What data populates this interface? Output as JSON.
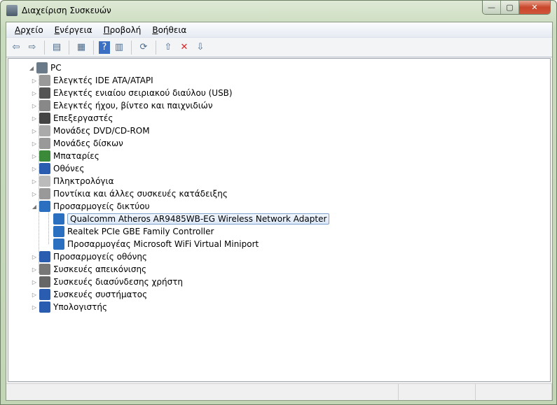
{
  "window": {
    "title": "Διαχείριση Συσκευών",
    "controls": {
      "minimize": "—",
      "maximize": "▢",
      "close": "✕"
    }
  },
  "menu": [
    {
      "key": "Α",
      "rest": "ρχείο"
    },
    {
      "key": "Ε",
      "rest": "νέργεια"
    },
    {
      "key": "Π",
      "rest": "ροβολή"
    },
    {
      "key": "Β",
      "rest": "οήθεια"
    }
  ],
  "toolbar": [
    {
      "icon": "back-icon",
      "glyph": "⇦"
    },
    {
      "icon": "forward-icon",
      "glyph": "⇨"
    },
    {
      "sep": true
    },
    {
      "icon": "show-hide-console-tree-icon",
      "glyph": "▤"
    },
    {
      "sep": true
    },
    {
      "icon": "properties-icon",
      "glyph": "▦"
    },
    {
      "sep": true
    },
    {
      "icon": "help-icon",
      "glyph": "?"
    },
    {
      "icon": "action-pane-icon",
      "glyph": "▥"
    },
    {
      "sep": true
    },
    {
      "icon": "scan-hardware-icon",
      "glyph": "⟳"
    },
    {
      "sep": true
    },
    {
      "icon": "update-driver-icon",
      "glyph": "⇧"
    },
    {
      "icon": "uninstall-icon",
      "glyph": "✕"
    },
    {
      "icon": "disable-icon",
      "glyph": "⇩"
    }
  ],
  "tree": {
    "root": "PC",
    "categories": [
      {
        "label": "Ελεγκτές IDE ATA/ATAPI",
        "color": "#999"
      },
      {
        "label": "Ελεγκτές ενιαίου σειριακού διαύλου (USB)",
        "color": "#555"
      },
      {
        "label": "Ελεγκτές ήχου, βίντεο και παιχνιδιών",
        "color": "#888"
      },
      {
        "label": "Επεξεργαστές",
        "color": "#444"
      },
      {
        "label": "Μονάδες DVD/CD-ROM",
        "color": "#aaa"
      },
      {
        "label": "Μονάδες δίσκων",
        "color": "#999"
      },
      {
        "label": "Μπαταρίες",
        "color": "#3a8a3a"
      },
      {
        "label": "Οθόνες",
        "color": "#2a5db0"
      },
      {
        "label": "Πληκτρολόγια",
        "color": "#bbb"
      },
      {
        "label": "Ποντίκια και άλλες συσκευές κατάδειξης",
        "color": "#999"
      },
      {
        "label": "Προσαρμογείς δικτύου",
        "color": "#2a6fc0",
        "expanded": true,
        "children": [
          {
            "label": "Qualcomm Atheros AR9485WB-EG Wireless Network Adapter",
            "selected": true
          },
          {
            "label": "Realtek PCIe GBE Family Controller"
          },
          {
            "label": "Προσαρμογέας Microsoft WiFi Virtual Miniport"
          }
        ]
      },
      {
        "label": "Προσαρμογείς οθόνης",
        "color": "#2a5db0"
      },
      {
        "label": "Συσκευές απεικόνισης",
        "color": "#777"
      },
      {
        "label": "Συσκευές διασύνδεσης χρήστη",
        "color": "#666"
      },
      {
        "label": "Συσκευές συστήματος",
        "color": "#2a5db0"
      },
      {
        "label": "Υπολογιστής",
        "color": "#2a5db0"
      }
    ]
  }
}
